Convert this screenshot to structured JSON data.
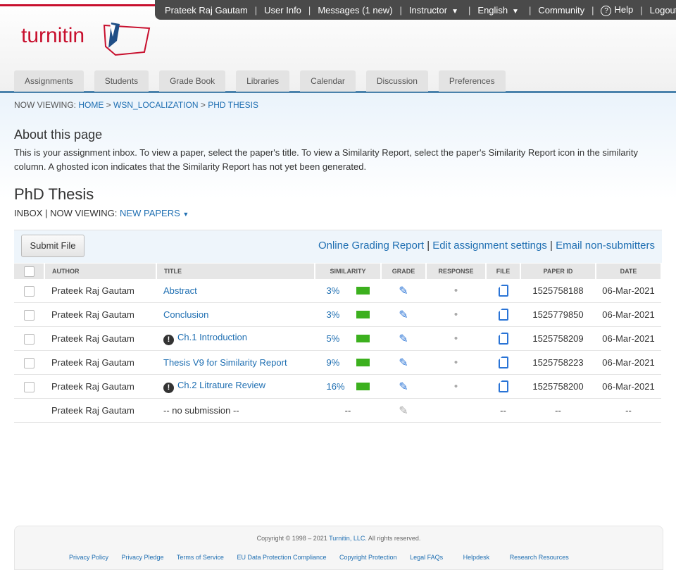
{
  "topnav": {
    "user": "Prateek Raj Gautam",
    "user_info": "User Info",
    "messages": "Messages (1 new)",
    "role": "Instructor",
    "language": "English",
    "community": "Community",
    "help": "Help",
    "logout": "Logout"
  },
  "logo": {
    "text": "turnitin"
  },
  "tabs": [
    "Assignments",
    "Students",
    "Grade Book",
    "Libraries",
    "Calendar",
    "Discussion",
    "Preferences"
  ],
  "breadcrumb": {
    "prefix": "NOW VIEWING:",
    "home": "HOME",
    "class": "WSN_LOCALIZATION",
    "assignment": "PHD THESIS"
  },
  "about": {
    "heading": "About this page",
    "text": "This is your assignment inbox. To view a paper, select the paper's title. To view a Similarity Report, select the paper's Similarity Report icon in the similarity column. A ghosted icon indicates that the Similarity Report has not yet been generated."
  },
  "assignment": {
    "title": "PhD Thesis",
    "inbox_label": "INBOX",
    "now_viewing_label": "| NOW VIEWING:",
    "filter": "NEW PAPERS"
  },
  "toolbar": {
    "submit": "Submit File",
    "online_grading": "Online Grading Report",
    "edit_settings": "Edit assignment settings",
    "email": "Email non-submitters"
  },
  "table": {
    "headers": [
      "AUTHOR",
      "TITLE",
      "SIMILARITY",
      "GRADE",
      "RESPONSE",
      "FILE",
      "PAPER ID",
      "DATE"
    ],
    "rows": [
      {
        "author": "Prateek Raj Gautam",
        "title": "Abstract",
        "alert": false,
        "similarity": "3%",
        "paper_id": "1525758188",
        "date": "06-Mar-2021"
      },
      {
        "author": "Prateek Raj Gautam",
        "title": "Conclusion",
        "alert": false,
        "similarity": "3%",
        "paper_id": "1525779850",
        "date": "06-Mar-2021"
      },
      {
        "author": "Prateek Raj Gautam",
        "title": "Ch.1 Introduction",
        "alert": true,
        "similarity": "5%",
        "paper_id": "1525758209",
        "date": "06-Mar-2021"
      },
      {
        "author": "Prateek Raj Gautam",
        "title": "Thesis V9 for Similarity Report",
        "alert": false,
        "similarity": "9%",
        "paper_id": "1525758223",
        "date": "06-Mar-2021"
      },
      {
        "author": "Prateek Raj Gautam",
        "title": "Ch.2 Litrature Review",
        "alert": true,
        "similarity": "16%",
        "paper_id": "1525758200",
        "date": "06-Mar-2021"
      }
    ],
    "no_submission": {
      "author": "Prateek Raj Gautam",
      "title": "-- no submission --",
      "similarity": "--",
      "file": "--",
      "paper_id": "--",
      "date": "--"
    }
  },
  "footer": {
    "copyright_prefix": "Copyright © 1998 – 2021",
    "company": "Turnitin, LLC.",
    "rights": "All rights reserved.",
    "links": [
      "Privacy Policy",
      "Privacy Pledge",
      "Terms of Service",
      "EU Data Protection Compliance",
      "Copyright Protection",
      "Legal FAQs",
      "Helpdesk",
      "Research Resources"
    ]
  },
  "colors": {
    "brand_red": "#c8102e",
    "link_blue": "#1f6fb2",
    "nav_dark": "#4a4a4a",
    "similarity_green": "#3cb01e"
  }
}
